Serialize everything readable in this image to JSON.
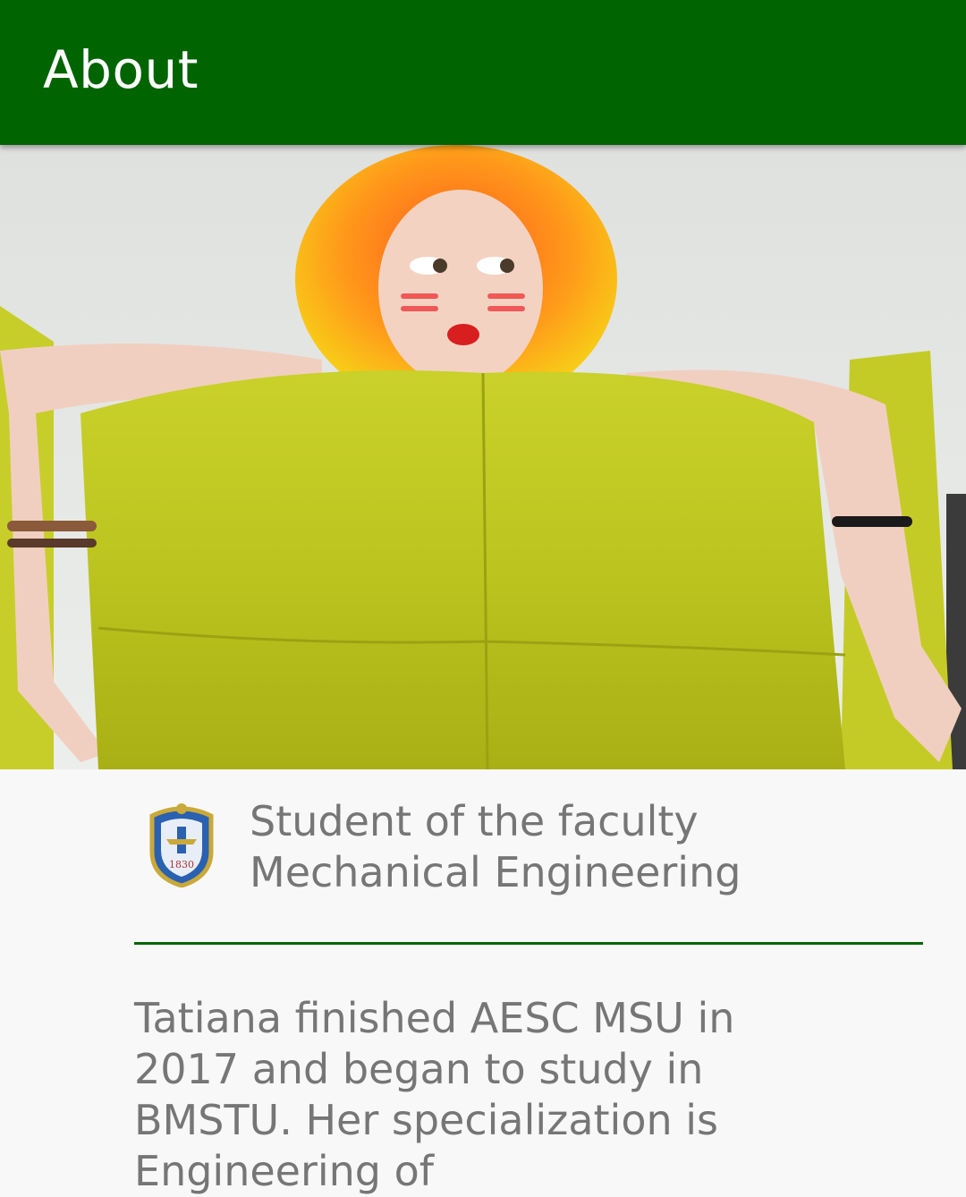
{
  "app_bar": {
    "title": "About",
    "color": "#006400"
  },
  "hero": {
    "image_description": "photo of student on a green sofa",
    "icon": "photo"
  },
  "faculty": {
    "emblem_icon": "university-crest-icon",
    "emblem_year": "1830",
    "text": "Student of the faculty Mechanical Engineering"
  },
  "divider_color": "#006400",
  "bio": {
    "text": "Tatiana finished AESC MSU in 2017 and began to study in BMSTU. Her specialization is Engineering of"
  },
  "colors": {
    "text_secondary": "#767676",
    "background": "#f8f8f8"
  }
}
